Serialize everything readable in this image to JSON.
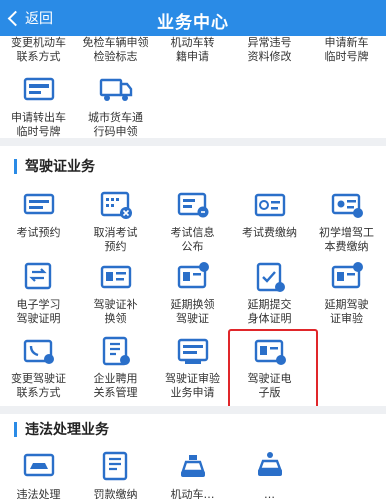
{
  "header": {
    "back_label": "返回",
    "title": "业务中心"
  },
  "top_partial_items": [
    {
      "l1": "变更机动车",
      "l2": "联系方式"
    },
    {
      "l1": "免检车辆申领",
      "l2": "检验标志"
    },
    {
      "l1": "机动车转",
      "l2": "籍申请"
    },
    {
      "l1": "异常违号",
      "l2": "资料修改"
    },
    {
      "l1": "申请新车",
      "l2": "临时号牌"
    }
  ],
  "vehicle_extra_items": [
    {
      "l1": "申请转出车",
      "l2": "临时号牌",
      "icon": "plate-card-icon"
    },
    {
      "l1": "城市货车通",
      "l2": "行码申领",
      "icon": "truck-pass-icon"
    }
  ],
  "license_section": {
    "title": "驾驶证业务",
    "items": [
      {
        "l1": "考试预约",
        "l2": "",
        "icon": "exam-booking-icon"
      },
      {
        "l1": "取消考试",
        "l2": "预约",
        "icon": "cancel-booking-icon"
      },
      {
        "l1": "考试信息",
        "l2": "公布",
        "icon": "exam-notice-icon"
      },
      {
        "l1": "考试费缴纳",
        "l2": "",
        "icon": "exam-fee-icon"
      },
      {
        "l1": "初学增驾工",
        "l2": "本费缴纳",
        "icon": "learner-fee-icon"
      },
      {
        "l1": "电子学习",
        "l2": "驾驶证明",
        "icon": "e-learning-icon"
      },
      {
        "l1": "驾驶证补",
        "l2": "换领",
        "icon": "license-replace-icon"
      },
      {
        "l1": "延期换领",
        "l2": "驾驶证",
        "icon": "delay-renew-icon"
      },
      {
        "l1": "延期提交",
        "l2": "身体证明",
        "icon": "health-proof-icon"
      },
      {
        "l1": "延期驾驶",
        "l2": "证审验",
        "icon": "delay-review-icon"
      },
      {
        "l1": "变更驾驶证",
        "l2": "联系方式",
        "icon": "license-contact-icon"
      },
      {
        "l1": "企业聘用",
        "l2": "关系管理",
        "icon": "enterprise-icon"
      },
      {
        "l1": "驾驶证审验",
        "l2": "业务申请",
        "icon": "review-apply-icon"
      },
      {
        "l1": "驾驶证电",
        "l2": "子版",
        "icon": "e-license-icon"
      }
    ]
  },
  "violation_section": {
    "title": "违法处理业务",
    "items": [
      {
        "l1": "违法处理",
        "icon": "violation-car-icon"
      },
      {
        "l1": "罚款缴纳",
        "icon": "fine-pay-icon"
      },
      {
        "l1": "机动车…",
        "icon": "vehicle-service-icon"
      },
      {
        "l1": "…",
        "icon": "car-record-icon"
      }
    ]
  },
  "colors": {
    "header": "#2a8be6",
    "icon_blue": "#2a6fc9",
    "highlight": "#e0262a"
  }
}
